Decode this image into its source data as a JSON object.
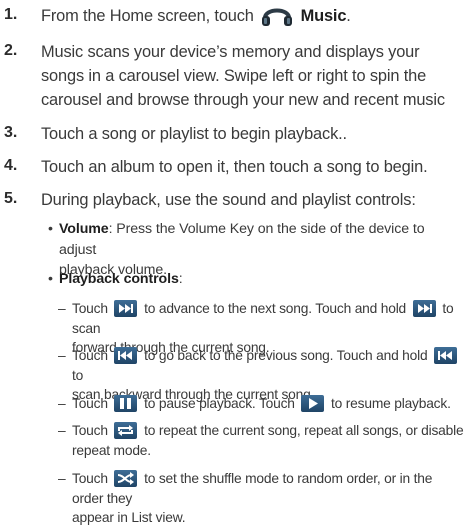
{
  "steps": [
    {
      "num": "1.",
      "pre": "From the Home screen, touch",
      "app": "Music",
      "post": "."
    },
    {
      "num": "2.",
      "line1": "Music scans your device’s memory and displays your",
      "line2": "songs in a carousel view. Swipe left or right to spin the",
      "line3": "carousel and browse through your new and recent music"
    },
    {
      "num": "3.",
      "text": "Touch a song or playlist to begin playback.."
    },
    {
      "num": "4.",
      "text": "Touch an album to open it, then touch a song to begin."
    },
    {
      "num": "5.",
      "text": "During playback, use the sound and playlist controls:"
    }
  ],
  "bullets": {
    "volume_label": "Volume",
    "volume_l1": ": Press the Volume Key on the side of the device to adjust",
    "volume_l2": "playback volume.",
    "playback_label": "Playback controls",
    "playback_colon": ":"
  },
  "controls": {
    "next_a": "Touch",
    "next_b": "to advance to the next song. Touch and hold",
    "next_c": "to scan",
    "next_l2": "forward through the current song.",
    "prev_a": "Touch",
    "prev_b": "to go back to the previous song. Touch and hold",
    "prev_c": "to",
    "prev_l2": "scan backward through the current song.",
    "pause_a": "Touch",
    "pause_b": "to pause playback. Touch",
    "pause_c": "to resume playback.",
    "repeat_a": "Touch",
    "repeat_b": "to repeat the current song, repeat all songs, or disable",
    "repeat_l2": "repeat mode.",
    "shuffle_a": "Touch",
    "shuffle_b": "to set the shuffle mode to random order, or in the order they",
    "shuffle_l2": "appear in List view."
  },
  "icons": [
    "headphones-icon",
    "next-track-icon",
    "previous-track-icon",
    "pause-icon",
    "play-icon",
    "repeat-icon",
    "shuffle-icon"
  ],
  "colors": {
    "text": "#3a3a3a",
    "icon_blue": "#2a5478"
  }
}
